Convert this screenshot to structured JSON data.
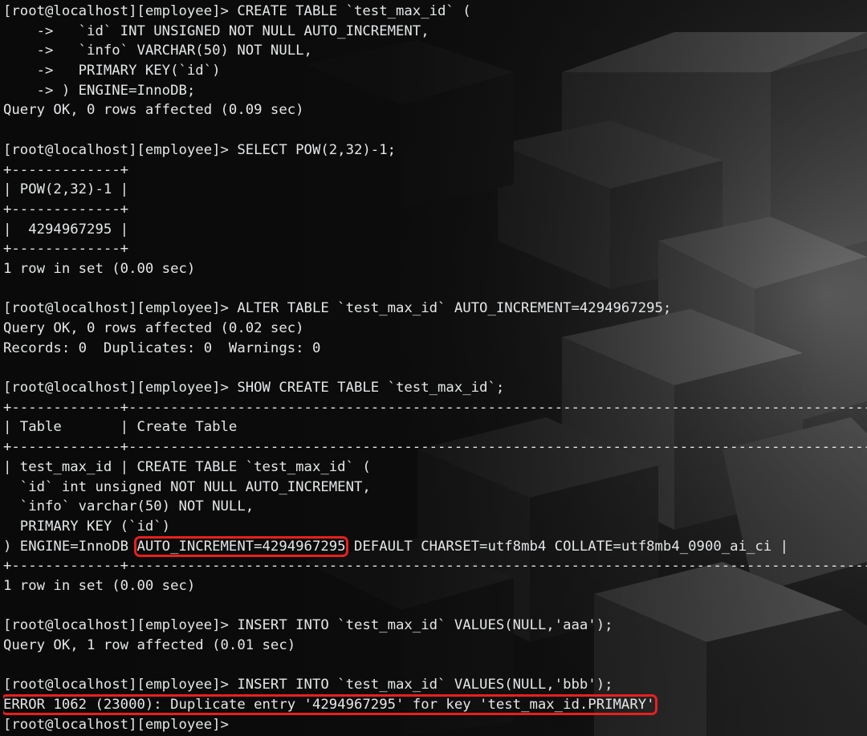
{
  "terminal": {
    "lines": [
      "[root@localhost][employee]> CREATE TABLE `test_max_id` (",
      "    ->   `id` INT UNSIGNED NOT NULL AUTO_INCREMENT,",
      "    ->   `info` VARCHAR(50) NOT NULL,",
      "    ->   PRIMARY KEY(`id`)",
      "    -> ) ENGINE=InnoDB;",
      "Query OK, 0 rows affected (0.09 sec)",
      "",
      "[root@localhost][employee]> SELECT POW(2,32)-1;",
      "+-------------+",
      "| POW(2,32)-1 |",
      "+-------------+",
      "|  4294967295 |",
      "+-------------+",
      "1 row in set (0.00 sec)",
      "",
      "[root@localhost][employee]> ALTER TABLE `test_max_id` AUTO_INCREMENT=4294967295;",
      "Query OK, 0 rows affected (0.02 sec)",
      "Records: 0  Duplicates: 0  Warnings: 0",
      "",
      "[root@localhost][employee]> SHOW CREATE TABLE `test_max_id`;",
      "+-------------+--------------------------------------------------------------------------------------------------------------------------------------",
      "| Table       | Create Table",
      "+-------------+--------------------------------------------------------------------------------------------------------------------------------------",
      "| test_max_id | CREATE TABLE `test_max_id` (",
      "  `id` int unsigned NOT NULL AUTO_INCREMENT,",
      "  `info` varchar(50) NOT NULL,",
      "  PRIMARY KEY (`id`)",
      [
        ") ENGINE=InnoDB ",
        "AUTO_INCREMENT=4294967295",
        " DEFAULT CHARSET=utf8mb4 COLLATE=utf8mb4_0900_ai_ci |"
      ],
      "+-------------+--------------------------------------------------------------------------------------------------------------------------------------",
      "1 row in set (0.00 sec)",
      "",
      "[root@localhost][employee]> INSERT INTO `test_max_id` VALUES(NULL,'aaa');",
      "Query OK, 1 row affected (0.01 sec)",
      "",
      "[root@localhost][employee]> INSERT INTO `test_max_id` VALUES(NULL,'bbb');",
      [
        "",
        "ERROR 1062 (23000): Duplicate entry '4294967295' for key 'test_max_id.PRIMARY'",
        ""
      ],
      "[root@localhost][employee]>"
    ],
    "highlighted_segments": [
      "AUTO_INCREMENT=4294967295",
      "ERROR 1062 (23000): Duplicate entry '4294967295' for key 'test_max_id.PRIMARY'"
    ],
    "colors": {
      "text": "#e4e6e8",
      "highlight_border": "#e8201d",
      "background": "#141414"
    }
  }
}
